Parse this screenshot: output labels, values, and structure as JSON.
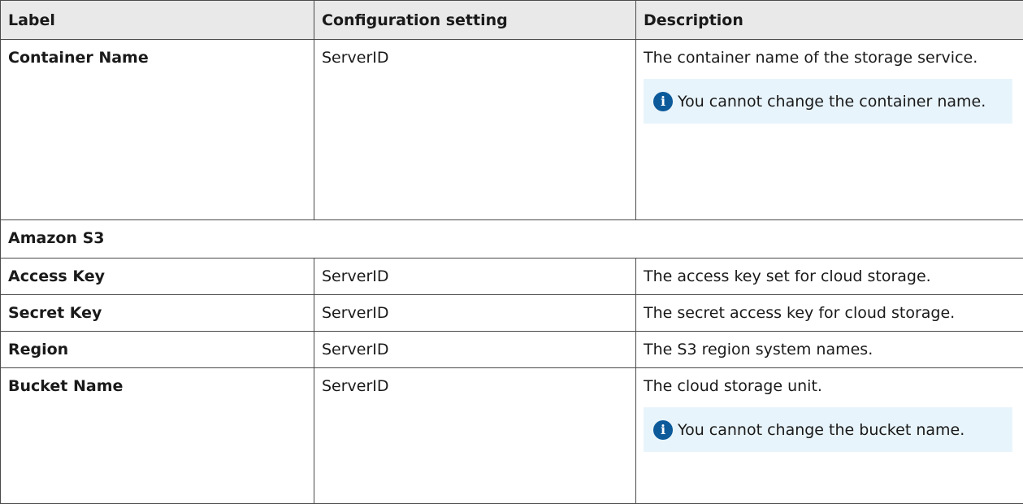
{
  "table": {
    "headers": [
      "Label",
      "Configuration setting",
      "Description"
    ],
    "rows": [
      {
        "label": "Container Name",
        "setting": "ServerID",
        "description": "The container name of the storage service.",
        "note": "You cannot change the container name.",
        "note_icon": "info-icon"
      },
      {
        "section": "Amazon S3"
      },
      {
        "label": "Access Key",
        "setting": "ServerID",
        "description": "The access key set for cloud storage."
      },
      {
        "label": "Secret Key",
        "setting": "ServerID",
        "description": "The secret access key for cloud storage."
      },
      {
        "label": "Region",
        "setting": "ServerID",
        "description": "The S3 region system names."
      },
      {
        "label": "Bucket Name",
        "setting": "ServerID",
        "description": "The cloud storage unit.",
        "note": "You cannot change the bucket name.",
        "note_icon": "info-icon"
      }
    ]
  },
  "colors": {
    "header_bg": "#e9e9e9",
    "note_bg": "#e8f4fb",
    "info_icon": "#0c5a9a",
    "border": "#4a4a4a"
  }
}
